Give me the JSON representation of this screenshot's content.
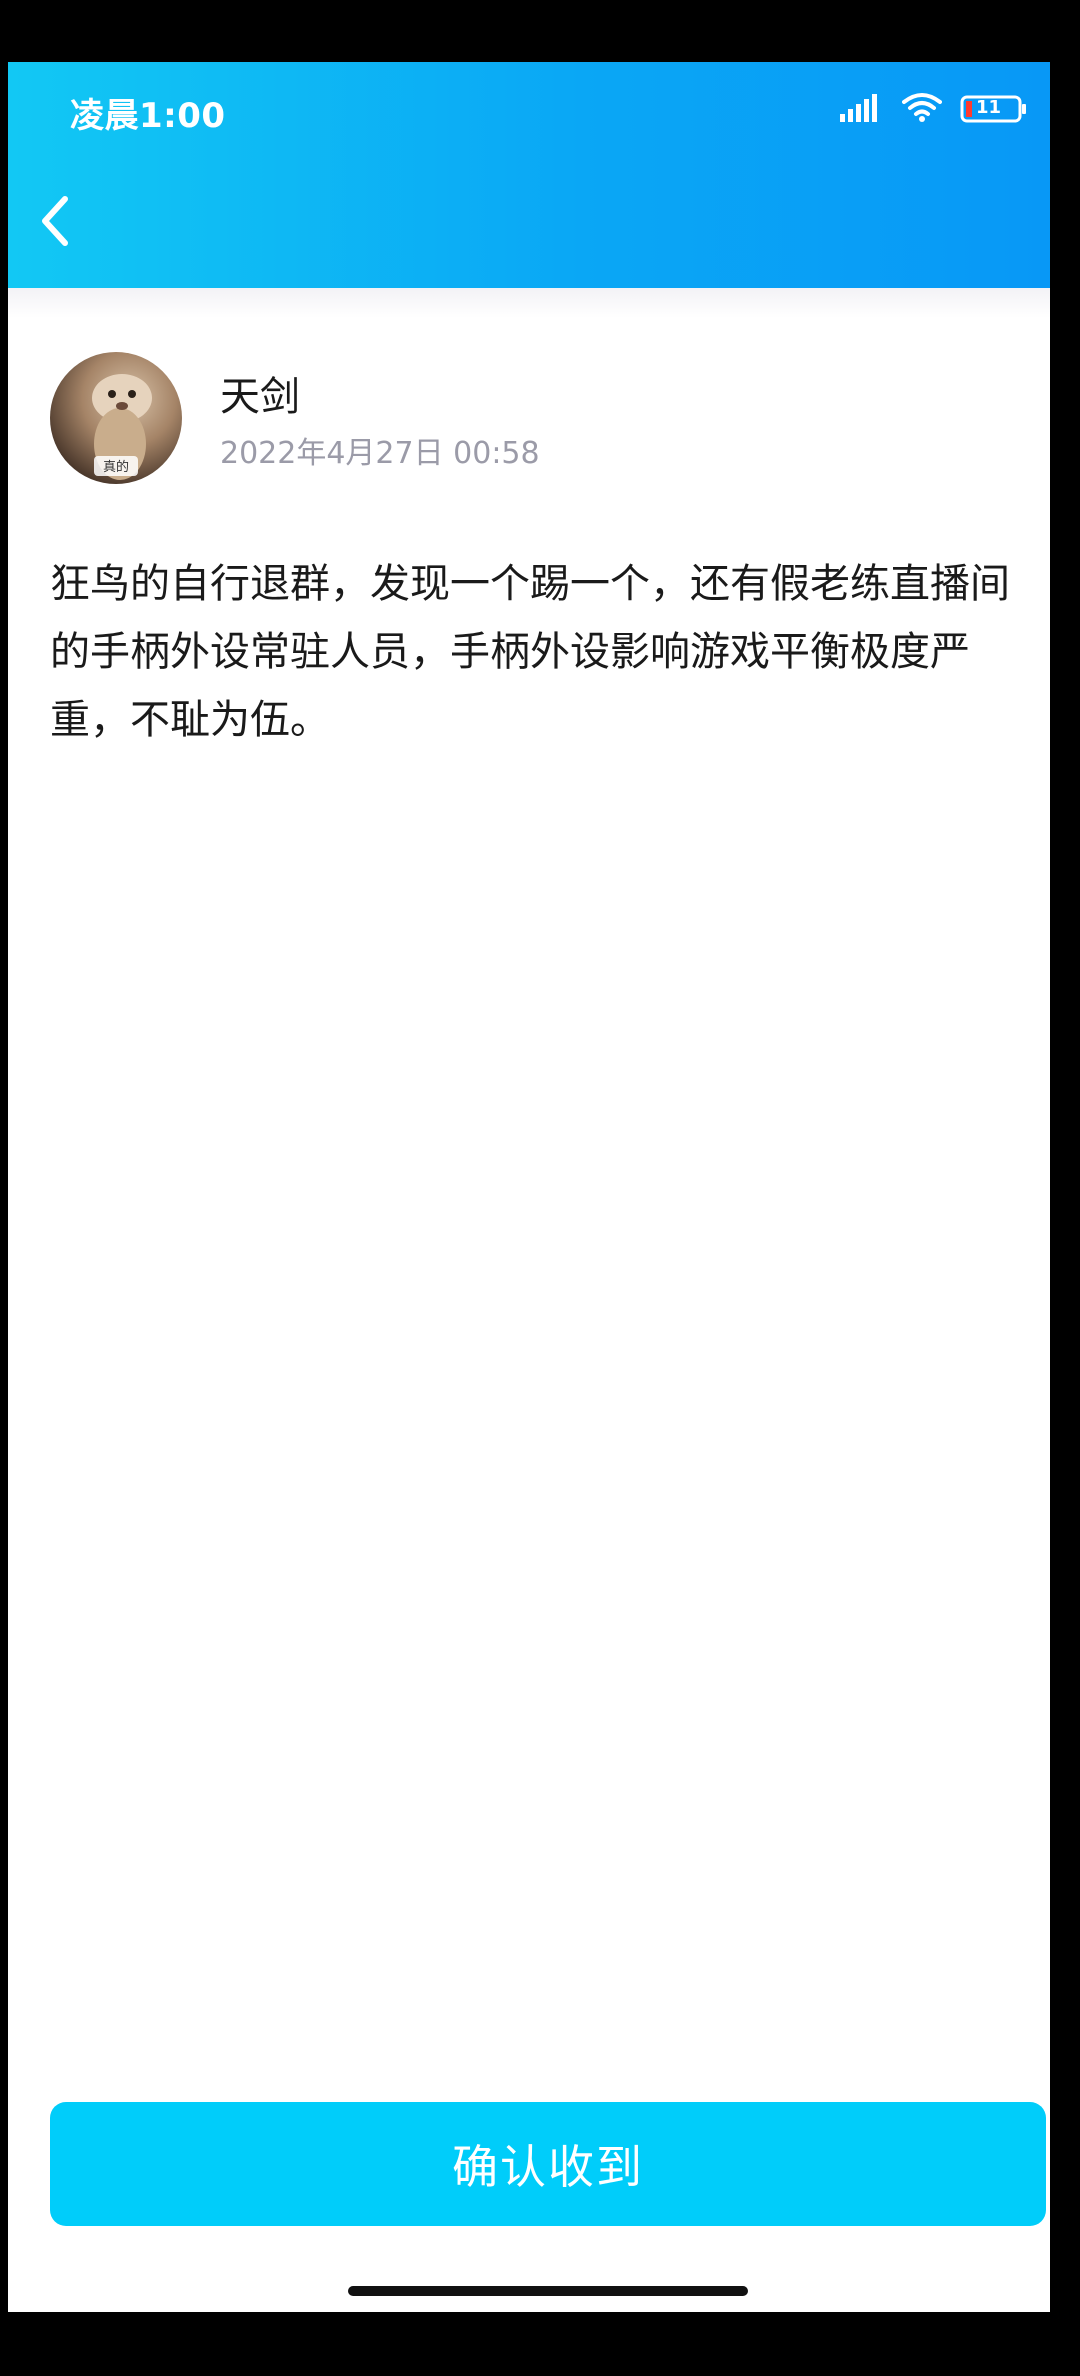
{
  "status_bar": {
    "time": "凌晨1:00",
    "battery": "11",
    "icons": [
      "signal-icon",
      "wifi-icon",
      "battery-icon"
    ]
  },
  "header": {
    "back_icon": "chevron-left-icon",
    "gradient_colors": [
      "#12c8f4",
      "#0898f6"
    ]
  },
  "post": {
    "author_name": "天剑",
    "date": "2022年4月27日 00:58",
    "avatar_badge": "真的",
    "body": "狂鸟的自行退群，发现一个踢一个，还有假老练直播间的手柄外设常驻人员，手柄外设影响游戏平衡极度严重，不耻为伍。"
  },
  "actions": {
    "confirm_label": "确认收到",
    "confirm_color": "#00cdfa"
  }
}
